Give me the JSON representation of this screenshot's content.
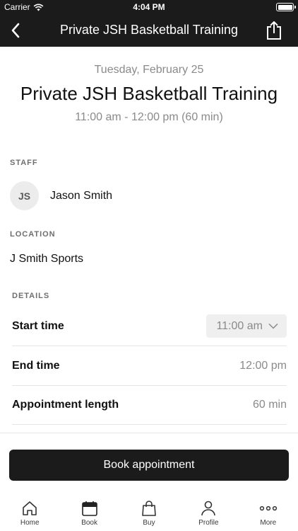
{
  "status_bar": {
    "carrier": "Carrier",
    "time": "4:04 PM"
  },
  "nav": {
    "title": "Private JSH Basketball Training",
    "back_icon": "chevron-left-icon",
    "share_icon": "share-icon"
  },
  "header": {
    "date": "Tuesday, February 25",
    "title": "Private JSH Basketball Training",
    "time_range": "11:00 am - 12:00 pm (60 min)"
  },
  "staff": {
    "label": "STAFF",
    "initials": "JS",
    "name": "Jason Smith"
  },
  "location": {
    "label": "LOCATION",
    "name": "J Smith Sports"
  },
  "details": {
    "label": "DETAILS",
    "start_time_label": "Start time",
    "start_time_value": "11:00 am",
    "end_time_label": "End time",
    "end_time_value": "12:00 pm",
    "length_label": "Appointment length",
    "length_value": "60 min"
  },
  "book_button": "Book appointment",
  "tabs": [
    {
      "label": "Home",
      "icon": "home-icon"
    },
    {
      "label": "Book",
      "icon": "calendar-icon"
    },
    {
      "label": "Buy",
      "icon": "shopping-bag-icon"
    },
    {
      "label": "Profile",
      "icon": "person-icon"
    },
    {
      "label": "More",
      "icon": "more-icon"
    }
  ],
  "colors": {
    "bar_dark": "#1b1b1b",
    "muted_text": "#8a8a8a",
    "avatar_bg": "#ececec"
  }
}
